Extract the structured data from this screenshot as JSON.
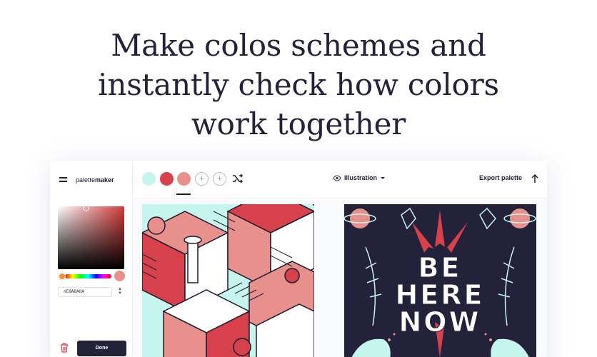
{
  "headline": {
    "line1": "Make colos schemes and",
    "line2": "instantly check how colors",
    "line3": "work together"
  },
  "app": {
    "menu_icon": "hamburger-icon",
    "logo_prefix": "palette",
    "logo_suffix": "maker",
    "palette": [
      "#c6f5ee",
      "#d7414b",
      "#e8908c"
    ],
    "add_icon": "plus-icon",
    "shuffle_icon": "shuffle-icon",
    "view_icon": "eye-icon",
    "view_label": "Illustration",
    "export_label": "Export palette",
    "upload_icon": "arrow-up-icon",
    "picker": {
      "hue_color": "#d63a3a",
      "current_color": "#e8908c",
      "hex_value": "#E8ABA8A",
      "delete_icon": "trash-icon",
      "done_label": "Done"
    },
    "poster": {
      "line1": "BE",
      "line2": "HERE",
      "line3": "NOW"
    }
  }
}
